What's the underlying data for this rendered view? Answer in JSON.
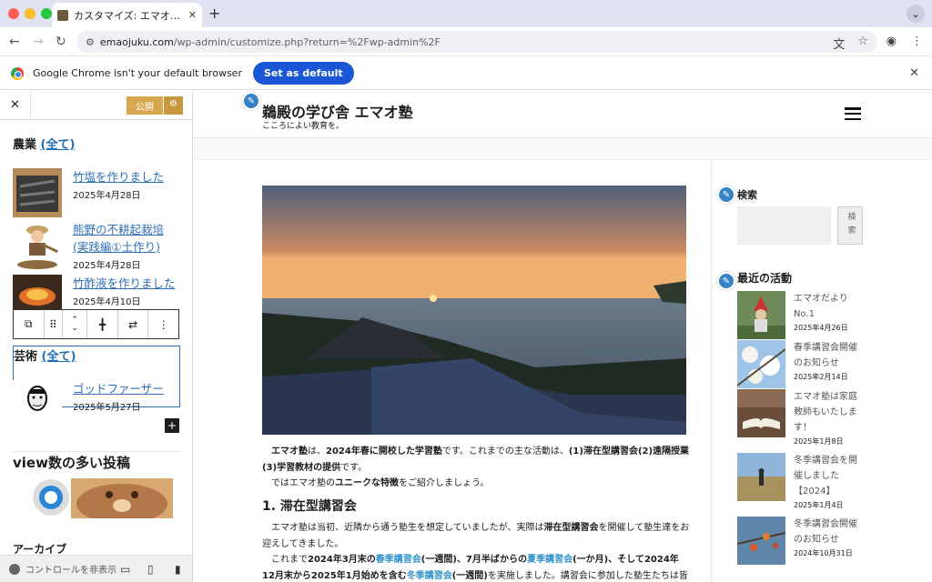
{
  "browser": {
    "tab_title": "カスタマイズ: エマオ塾へようこそ",
    "url_host": "emaojuku.com",
    "url_path": "/wp-admin/customize.php?return=%2Fwp-admin%2F",
    "infobar_text": "Google Chrome isn't your default browser",
    "set_default_label": "Set as default"
  },
  "customizer": {
    "publish_label": "公開",
    "footer_hide_label": "コントロールを非表示",
    "sections": [
      {
        "name": "農業",
        "all_label": "(全て)"
      },
      {
        "name": "芸術",
        "all_label": "(全て)"
      }
    ],
    "agri_posts": [
      {
        "title": "竹塩を作りました",
        "date": "2025年4月28日"
      },
      {
        "title": "熊野の不耕起栽培(実践編①土作り)",
        "date": "2025年4月28日"
      },
      {
        "title": "竹酢液を作りました",
        "date": "2025年4月10日"
      }
    ],
    "art_posts": [
      {
        "title": "ゴッドファーザー",
        "date": "2025年5月27日"
      }
    ],
    "views_title": "view数の多い投稿",
    "archive_title": "アーカイブ"
  },
  "site": {
    "title": "鵜殿の学び舎 エマオ塾",
    "tagline": "こころによい教育を。",
    "article": {
      "p1_a": "エマオ塾",
      "p1_b": "は、",
      "p1_c": "2024年春に開校した学習塾",
      "p1_d": "です。これまでの主な活動は、",
      "p1_e": "(1)滞在型講習会(2)遠隔授業(3)学習教材の提供",
      "p1_f": "です。",
      "p2_a": "ではエマオ塾の",
      "p2_b": "ユニークな特徴",
      "p2_c": "をご紹介しましょう。",
      "h2": "1. 滞在型講習会",
      "p3_a": "エマオ塾は当初、近隣から通う塾生を想定していましたが、実際は",
      "p3_b": "滞在型講習会",
      "p3_c": "を開催して塾生達をお迎えしてきました。",
      "p4_a": "これまで",
      "p4_b": "2024年3月末の",
      "p4_c": "春季講習会",
      "p4_d": "(一週間)、7月半ばからの",
      "p4_e": "夏季講習会",
      "p4_f": "(一か月)、そして",
      "p4_g": "2024年12月末から2025年1月始めを含む",
      "p4_h": "冬季講習会",
      "p4_i": "(一週間)",
      "p4_j": "を実施しました。講習会に参加した塾生たちは皆遠方か"
    },
    "search_widget_title": "検索",
    "search_button": "検索",
    "recent_widget_title": "最近の活動",
    "recent_posts": [
      {
        "title": "エマオだよりNo.1",
        "date": "2025年4月26日"
      },
      {
        "title": "春季講習会開催のお知らせ",
        "date": "2025年2月14日"
      },
      {
        "title": "エマオ塾は家庭教師もいたします！",
        "date": "2025年1月8日"
      },
      {
        "title": "冬季講習会を開催しました【2024】",
        "date": "2025年1月4日"
      },
      {
        "title": "冬季講習会開催のお知らせ",
        "date": "2024年10月31日"
      }
    ]
  }
}
